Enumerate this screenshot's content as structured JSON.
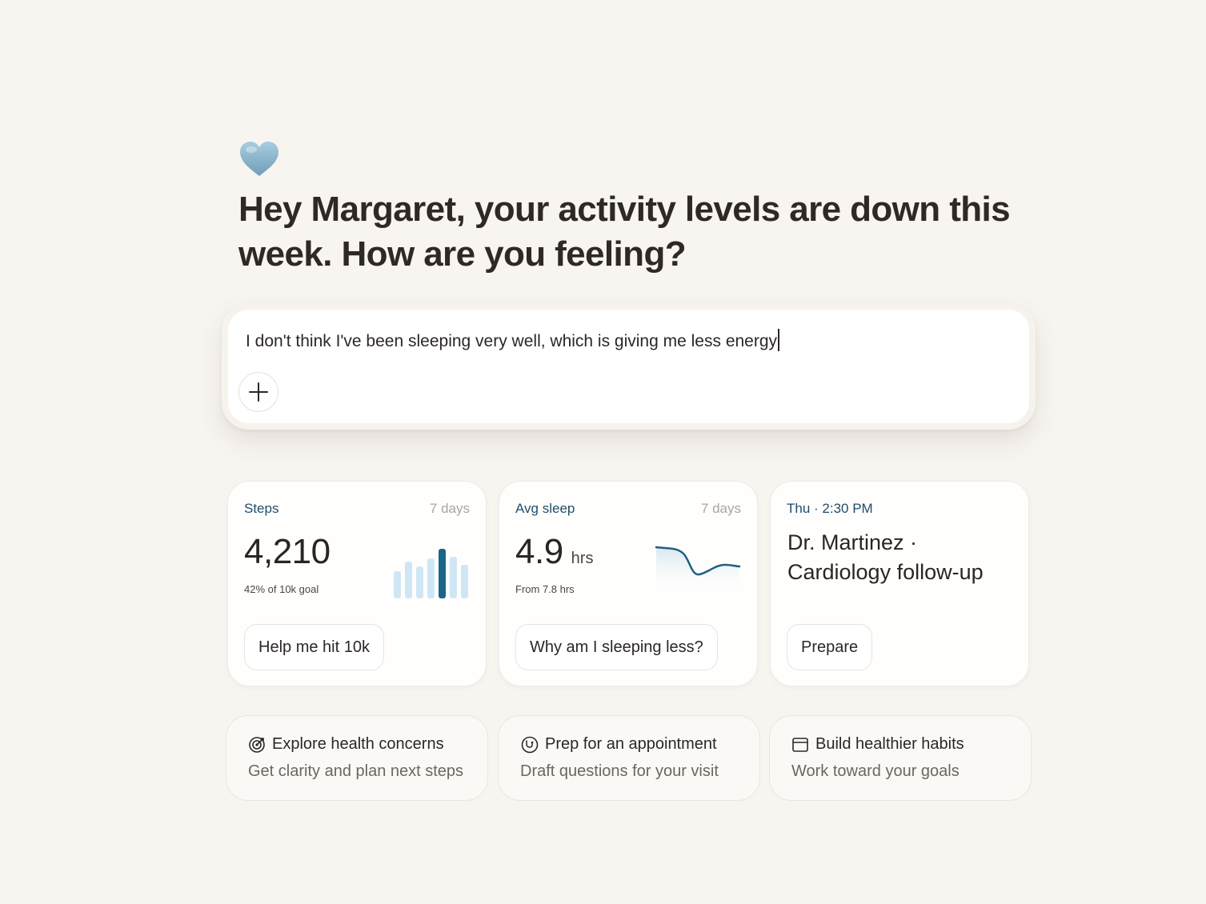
{
  "header": {
    "icon": "heart-icon",
    "headline": "Hey Margaret, your activity levels are down this week. How are you feeling?"
  },
  "composer": {
    "value": "I don't think I've been sleeping very well, which is giving me less energy",
    "add_icon": "plus-icon"
  },
  "cards": {
    "steps": {
      "label": "Steps",
      "period": "7 days",
      "value": "4,210",
      "sub": "42% of 10k goal",
      "action": "Help me hit 10k"
    },
    "sleep": {
      "label": "Avg sleep",
      "period": "7 days",
      "value": "4.9",
      "unit": "hrs",
      "sub": "From 7.8 hrs",
      "action": "Why am I sleeping less?"
    },
    "appointment": {
      "label": "Thu · 2:30 PM",
      "title_line1": "Dr. Martinez ·",
      "title_line2": "Cardiology follow-up",
      "action": "Prepare"
    }
  },
  "actions": [
    {
      "icon": "target-icon",
      "title": "Explore health concerns",
      "sub": "Get clarity and plan next steps"
    },
    {
      "icon": "stethoscope-icon",
      "title": "Prep for an appointment",
      "sub": "Draft questions for your visit"
    },
    {
      "icon": "calendar-icon",
      "title": "Build healthier habits",
      "sub": "Work toward your goals"
    }
  ],
  "colors": {
    "background": "#f8f5f1",
    "accent": "#1f5f84",
    "label": "#1f4d6b",
    "bar_light": "#cfe7f5",
    "bar_active": "#1a6688",
    "heart": "#8bb4cc"
  }
}
